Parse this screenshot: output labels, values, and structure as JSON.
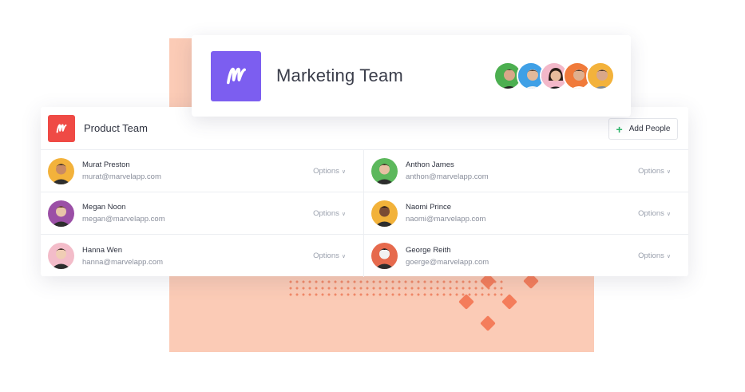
{
  "marketing": {
    "title": "Marketing Team",
    "members": [
      {
        "icon": "avatar-green-bg",
        "color": "#4caf50"
      },
      {
        "icon": "avatar-blue-bg",
        "color": "#3fa0e6"
      },
      {
        "icon": "avatar-pink-bg",
        "color": "#f3b8c9"
      },
      {
        "icon": "avatar-orange-bg",
        "color": "#f07a3a"
      },
      {
        "icon": "avatar-yellow-bg",
        "color": "#f3b23b"
      }
    ]
  },
  "product": {
    "title": "Product Team",
    "add_label": "Add People",
    "people": [
      {
        "name": "Murat Preston",
        "email": "murat@marvelapp.com",
        "options": "Options",
        "bg": "#f3b23b",
        "skin": "#c98a64",
        "hair": "#3b2a22"
      },
      {
        "name": "Anthon James",
        "email": "anthon@marvelapp.com",
        "options": "Options",
        "bg": "#5cb85c",
        "skin": "#e6c0a2",
        "hair": "#3e2c21"
      },
      {
        "name": "Megan Noon",
        "email": "megan@marvelapp.com",
        "options": "Options",
        "bg": "#9b4fa6",
        "skin": "#e8c3a8",
        "hair": "#5a3422"
      },
      {
        "name": "Naomi Prince",
        "email": "naomi@marvelapp.com",
        "options": "Options",
        "bg": "#f2b23a",
        "skin": "#7a4b33",
        "hair": "#1d1411"
      },
      {
        "name": "Hanna Wen",
        "email": "hanna@marvelapp.com",
        "options": "Options",
        "bg": "#f3bcc9",
        "skin": "#f0cdb4",
        "hair": "#2c2019"
      },
      {
        "name": "George Reith",
        "email": "goerge@marvelapp.com",
        "options": "Options",
        "bg": "#e66a4d",
        "skin": "#f2f2f2",
        "hair": "#111111"
      }
    ]
  },
  "colors": {
    "accent_purple": "#7c5ef0",
    "accent_red": "#ef4a45",
    "peach": "#fbcbb6",
    "plus_green": "#2fb86b"
  }
}
